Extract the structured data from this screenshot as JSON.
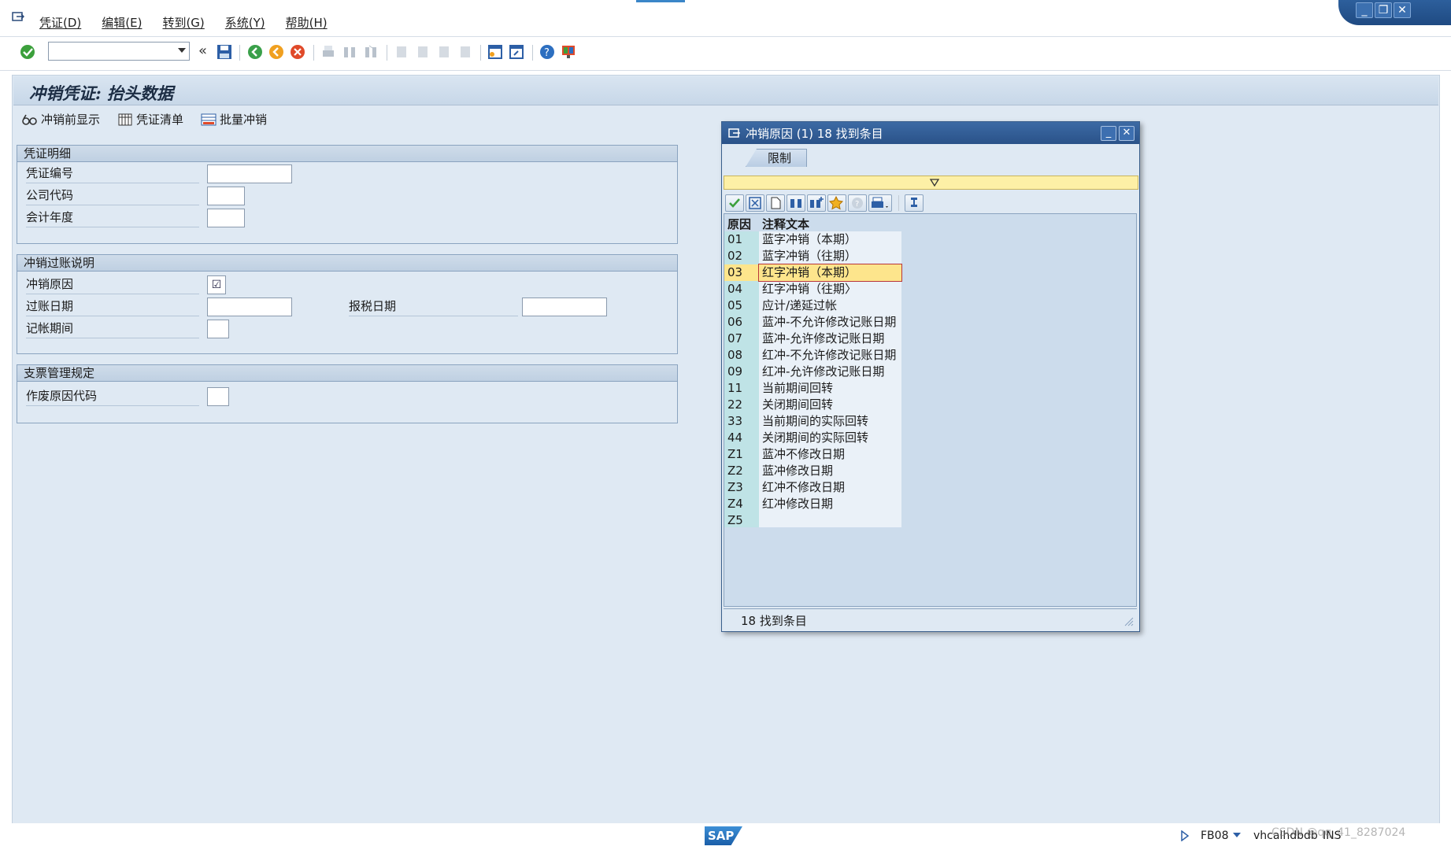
{
  "menubar": {
    "items": [
      "凭证(D)",
      "编辑(E)",
      "转到(G)",
      "系统(Y)",
      "帮助(H)"
    ]
  },
  "toolbar": {
    "command_field_value": "",
    "icons": [
      "enter-icon",
      "save-icon",
      "back-icon",
      "exit-icon",
      "cancel-icon",
      "print-icon",
      "find-icon",
      "find-next-icon",
      "first-page-icon",
      "prev-page-icon",
      "next-page-icon",
      "last-page-icon",
      "new-session-icon",
      "shortcut-icon",
      "help-icon",
      "customize-layout-icon"
    ]
  },
  "page": {
    "title": "冲销凭证: 抬头数据"
  },
  "app_toolbar": {
    "preview": "冲销前显示",
    "list": "凭证清单",
    "mass": "批量冲销"
  },
  "groups": {
    "doc_details": {
      "title": "凭证明细",
      "doc_number_label": "凭证编号",
      "company_code_label": "公司代码",
      "fiscal_year_label": "会计年度"
    },
    "reversal": {
      "title": "冲销过账说明",
      "reason_label": "冲销原因",
      "posting_date_label": "过账日期",
      "tax_date_label": "报税日期",
      "period_label": "记帐期间"
    },
    "cheque": {
      "title": "支票管理规定",
      "void_reason_label": "作废原因代码"
    }
  },
  "popup": {
    "title": "冲销原因 (1)   18 找到条目",
    "tab": "限制",
    "col_code": "原因",
    "col_text": "注释文本",
    "rows": [
      {
        "code": "01",
        "text": "蓝字冲销（本期）"
      },
      {
        "code": "02",
        "text": "蓝字冲销（往期）"
      },
      {
        "code": "03",
        "text": "红字冲销（本期）"
      },
      {
        "code": "04",
        "text": "红字冲销（往期〉"
      },
      {
        "code": "05",
        "text": "应计/递延过帐"
      },
      {
        "code": "06",
        "text": "蓝冲-不允许修改记账日期"
      },
      {
        "code": "07",
        "text": "蓝冲-允许修改记账日期"
      },
      {
        "code": "08",
        "text": "红冲-不允许修改记账日期"
      },
      {
        "code": "09",
        "text": "红冲-允许修改记账日期"
      },
      {
        "code": "11",
        "text": "当前期间回转"
      },
      {
        "code": "22",
        "text": "关闭期间回转"
      },
      {
        "code": "33",
        "text": "当前期间的实际回转"
      },
      {
        "code": "44",
        "text": "关闭期间的实际回转"
      },
      {
        "code": "Z1",
        "text": "蓝冲不修改日期"
      },
      {
        "code": "Z2",
        "text": "蓝冲修改日期"
      },
      {
        "code": "Z3",
        "text": "红冲不修改日期"
      },
      {
        "code": "Z4",
        "text": "红冲修改日期"
      },
      {
        "code": "Z5",
        "text": ""
      }
    ],
    "selected_code": "03",
    "status": "18 找到条目"
  },
  "statusbar": {
    "logo": "SAP",
    "transaction": "FB08",
    "server": "vhcalhdbdb",
    "mode": "INS",
    "watermark": "CSDN @qq_41_8287024"
  },
  "colors": {
    "accent": "#2a5289",
    "background": "#dfe9f3",
    "selected_row": "#fde58c"
  }
}
